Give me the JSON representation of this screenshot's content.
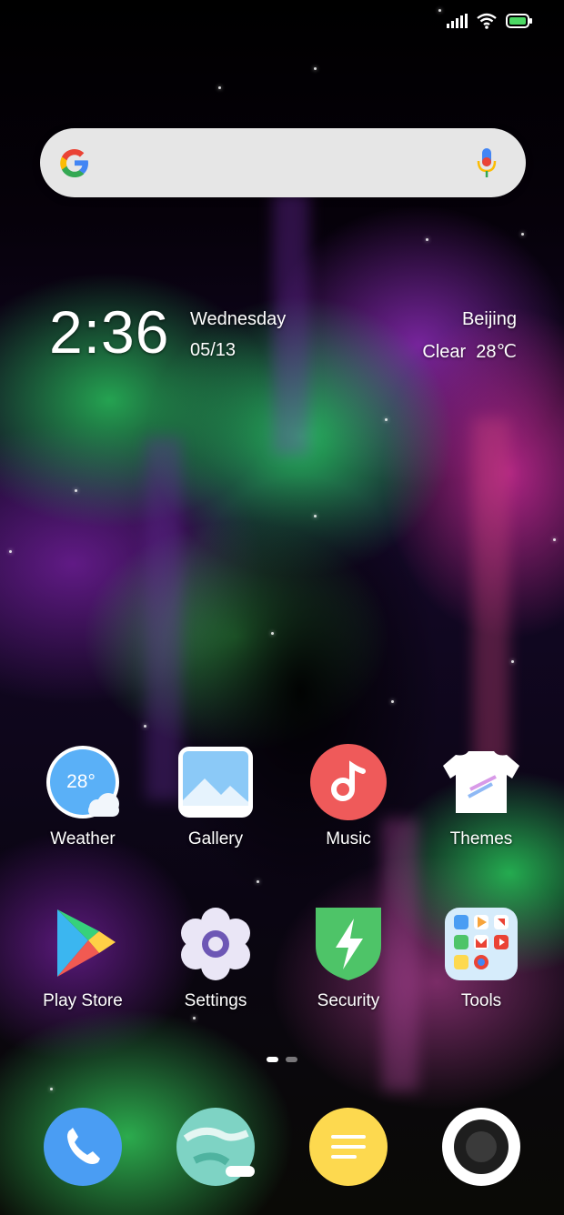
{
  "status_bar": {
    "signal_icon": "cellular-signal-icon",
    "wifi_icon": "wifi-icon",
    "battery_icon": "battery-icon",
    "battery_color": "#4cd964"
  },
  "search": {
    "logo_icon": "google-logo-icon",
    "mic_icon": "microphone-icon"
  },
  "clock_widget": {
    "time": "2:36",
    "day": "Wednesday",
    "date": "05/13",
    "city": "Beijing",
    "weather": "Clear  28℃"
  },
  "apps": [
    {
      "label": "Weather",
      "icon": "weather-icon",
      "badge_text": "28°"
    },
    {
      "label": "Gallery",
      "icon": "gallery-icon"
    },
    {
      "label": "Music",
      "icon": "music-icon"
    },
    {
      "label": "Themes",
      "icon": "themes-icon"
    },
    {
      "label": "Play Store",
      "icon": "play-store-icon"
    },
    {
      "label": "Settings",
      "icon": "settings-icon"
    },
    {
      "label": "Security",
      "icon": "security-icon"
    },
    {
      "label": "Tools",
      "icon": "tools-folder-icon"
    }
  ],
  "page_indicator": {
    "pages": 2,
    "current": 1
  },
  "dock": [
    {
      "icon": "phone-icon"
    },
    {
      "icon": "browser-icon"
    },
    {
      "icon": "messages-icon"
    },
    {
      "icon": "camera-icon"
    }
  ],
  "colors": {
    "weather": "#5ab0f7",
    "music": "#ef5a5a",
    "security": "#4ec468",
    "phone": "#4a9df3",
    "messages": "#fdd94f",
    "browser": "#7ed3c4"
  }
}
